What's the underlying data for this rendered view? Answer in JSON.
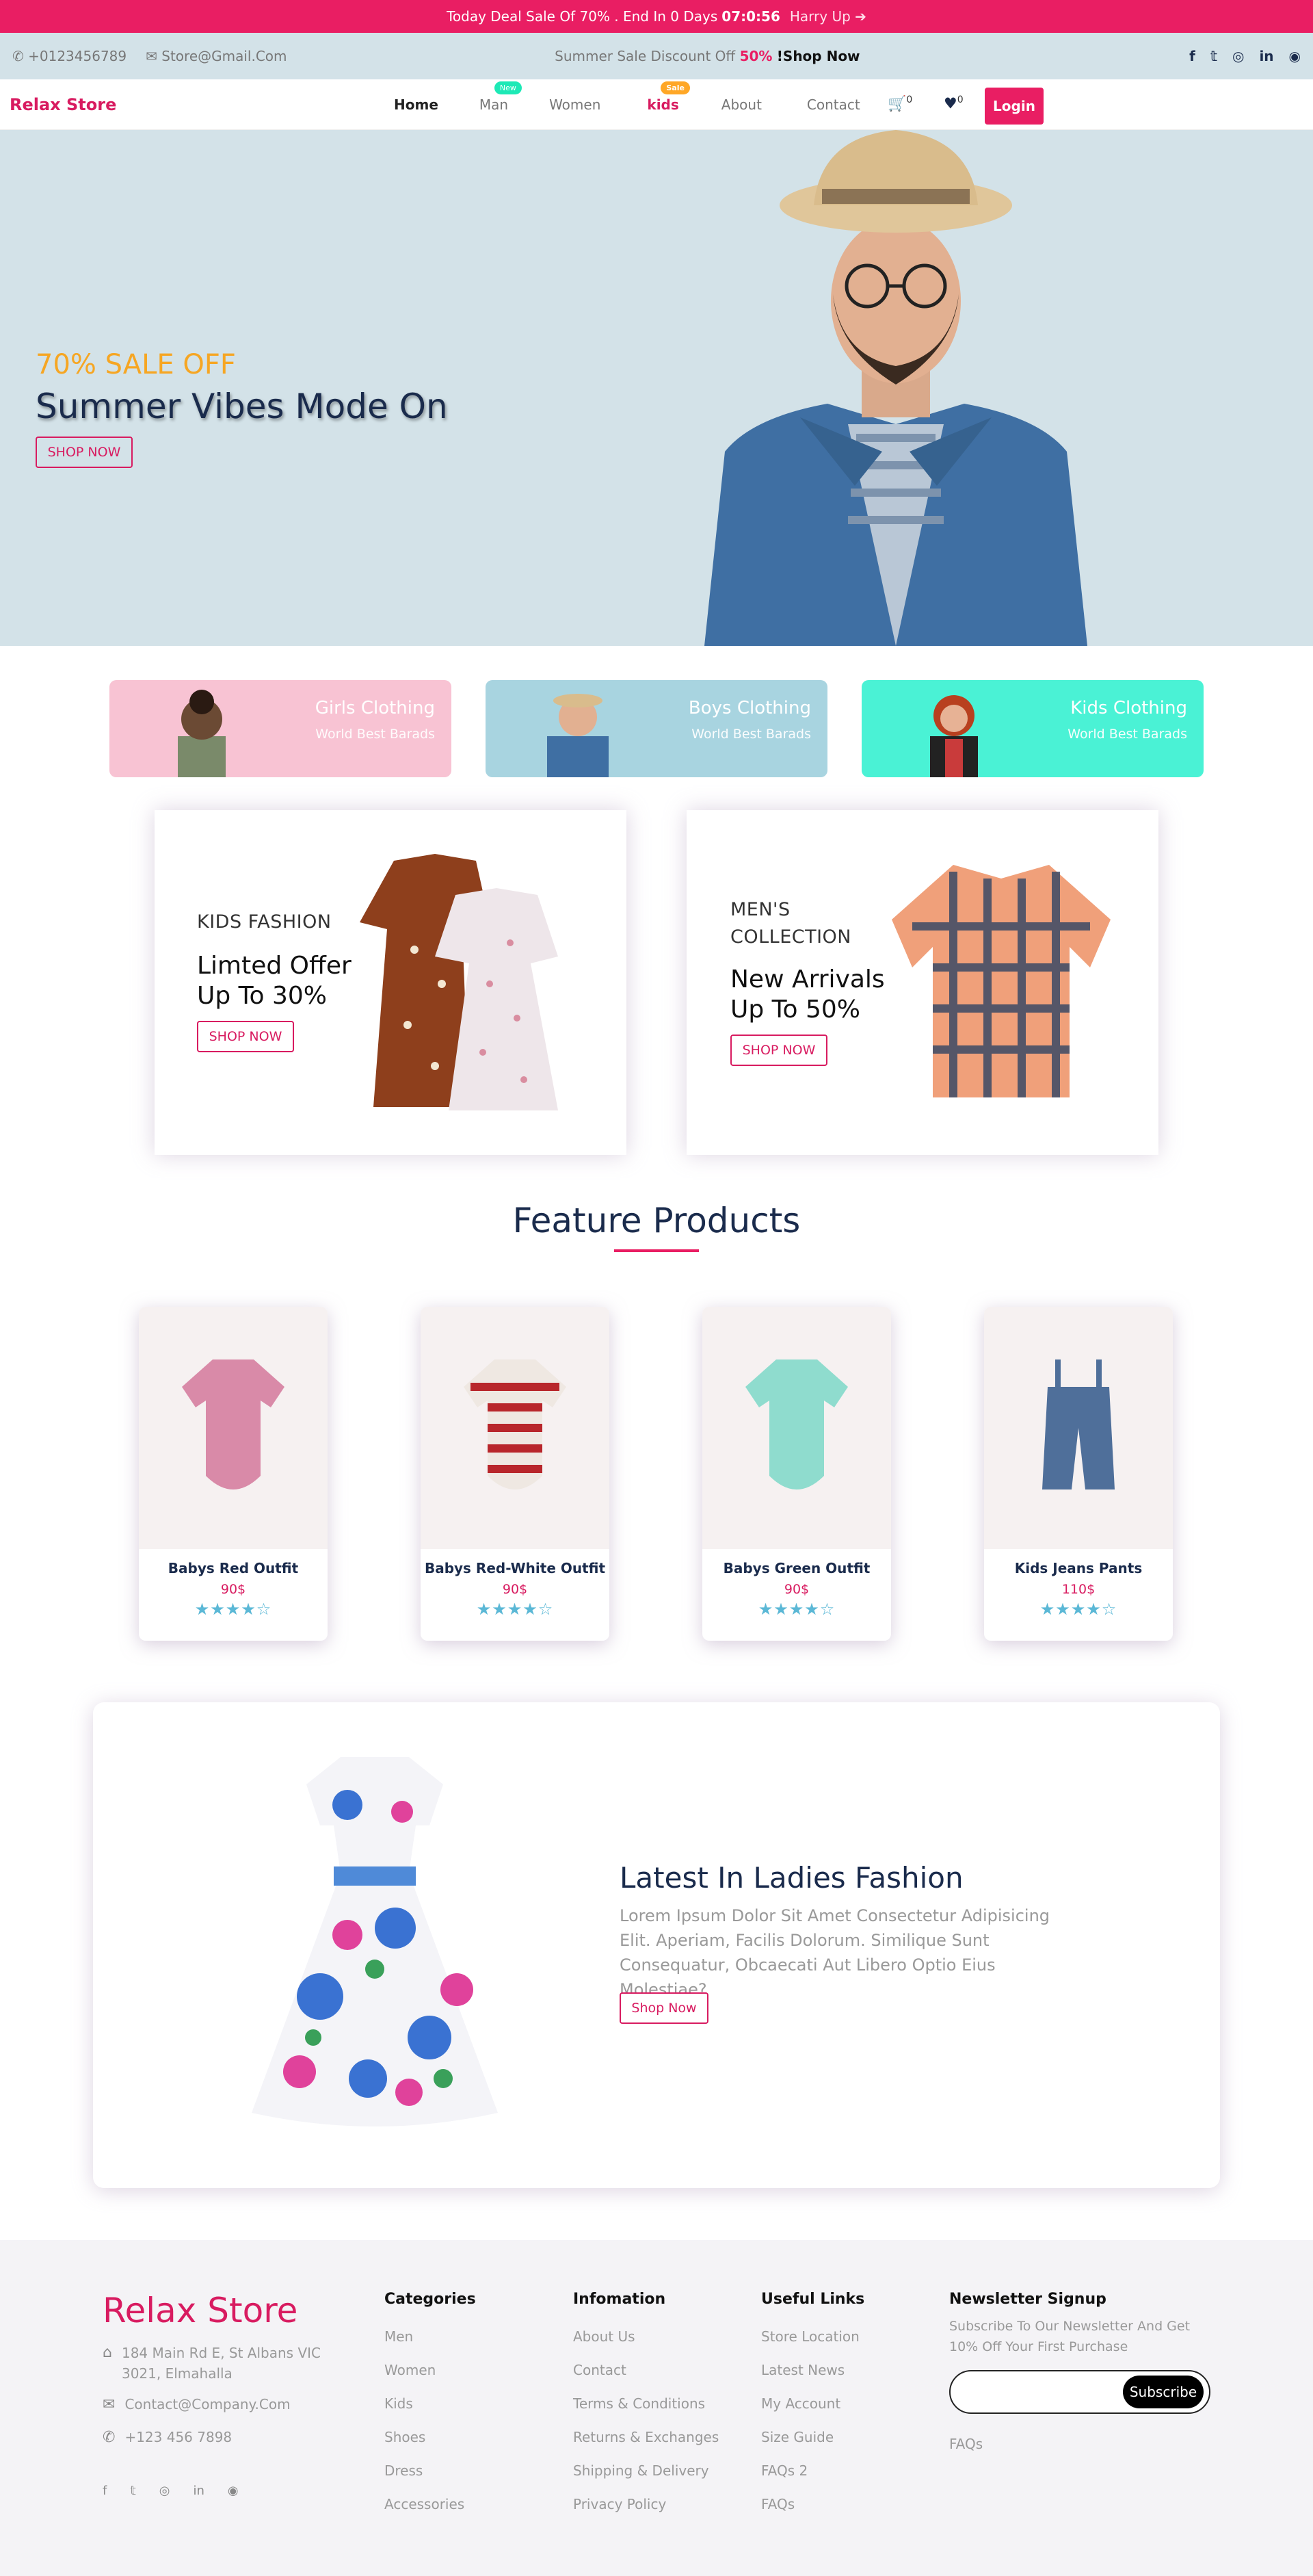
{
  "topbar": {
    "text": "Today Deal Sale Of 70% . End In 0 Days",
    "timer": "07:0:56",
    "hurry": "Harry Up",
    "hurry_icon": "arrow-right-icon"
  },
  "infobar": {
    "phone": "+0123456789",
    "email": "Store@Gmail.Com",
    "promo_text": "Summer Sale Discount Off",
    "promo_pct": "50%",
    "promo_link": "!Shop Now",
    "social": [
      "facebook-icon",
      "twitter-icon",
      "instagram-icon",
      "linkedin-icon",
      "github-icon"
    ]
  },
  "nav": {
    "brand": "Relax Store",
    "items": [
      {
        "label": "Home"
      },
      {
        "label": "Man",
        "badge": "New"
      },
      {
        "label": "Women"
      },
      {
        "label": "kids",
        "badge": "Sale"
      },
      {
        "label": "About"
      },
      {
        "label": "Contact"
      }
    ],
    "cart_count": "0",
    "wish_count": "0",
    "login": "Login"
  },
  "hero": {
    "sale": "70% SALE OFF",
    "title": "Summer Vibes Mode On",
    "button": "SHOP NOW"
  },
  "categories": [
    {
      "title": "Girls Clothing",
      "subtitle": "World Best Barads",
      "color": "#f8c3d3"
    },
    {
      "title": "Boys Clothing",
      "subtitle": "World Best Barads",
      "color": "#a8d4e0"
    },
    {
      "title": "Kids Clothing",
      "subtitle": "World Best Barads",
      "color": "#4af2d5"
    }
  ],
  "promos": [
    {
      "kicker": "KIDS FASHION",
      "title1": "Limted Offer",
      "title2": "Up To 30%",
      "button": "SHOP NOW"
    },
    {
      "kicker1": "MEN'S",
      "kicker2": "COLLECTION",
      "title1": "New Arrivals",
      "title2": "Up To 50%",
      "button": "SHOP NOW"
    }
  ],
  "features": {
    "title": "Feature Products",
    "products": [
      {
        "name": "Babys Red Outfit",
        "price": "90$",
        "rating": 4
      },
      {
        "name": "Babys Red-White Outfit",
        "price": "90$",
        "rating": 4
      },
      {
        "name": "Babys Green Outfit",
        "price": "90$",
        "rating": 4
      },
      {
        "name": "Kids Jeans Pants",
        "price": "110$",
        "rating": 4
      }
    ]
  },
  "ladies": {
    "title": "Latest In Ladies Fashion",
    "text": "Lorem Ipsum Dolor Sit Amet Consectetur Adipisicing Elit. Aperiam, Facilis Dolorum. Similique Sunt Consequatur, Obcaecati Aut Libero Optio Eius Molestiae?",
    "button": "Shop Now"
  },
  "footer": {
    "brand": "Relax Store",
    "address": "184 Main Rd E, St Albans VIC 3021, Elmahalla",
    "email": "Contact@Company.Com",
    "phone": "+123 456 7898",
    "categories": {
      "title": "Categories",
      "items": [
        "Men",
        "Women",
        "Kids",
        "Shoes",
        "Dress",
        "Accessories"
      ]
    },
    "information": {
      "title": "Infomation",
      "items": [
        "About Us",
        "Contact",
        "Terms & Conditions",
        "Returns & Exchanges",
        "Shipping & Delivery",
        "Privacy Policy"
      ]
    },
    "links": {
      "title": "Useful Links",
      "items": [
        "Store Location",
        "Latest News",
        "My Account",
        "Size Guide",
        "FAQs 2",
        "FAQs"
      ]
    },
    "newsletter": {
      "title": "Newsletter Signup",
      "text": "Subscribe To Our Newsletter And Get 10% Off Your First Purchase",
      "button": "Subscribe",
      "faq": "FAQs"
    }
  }
}
